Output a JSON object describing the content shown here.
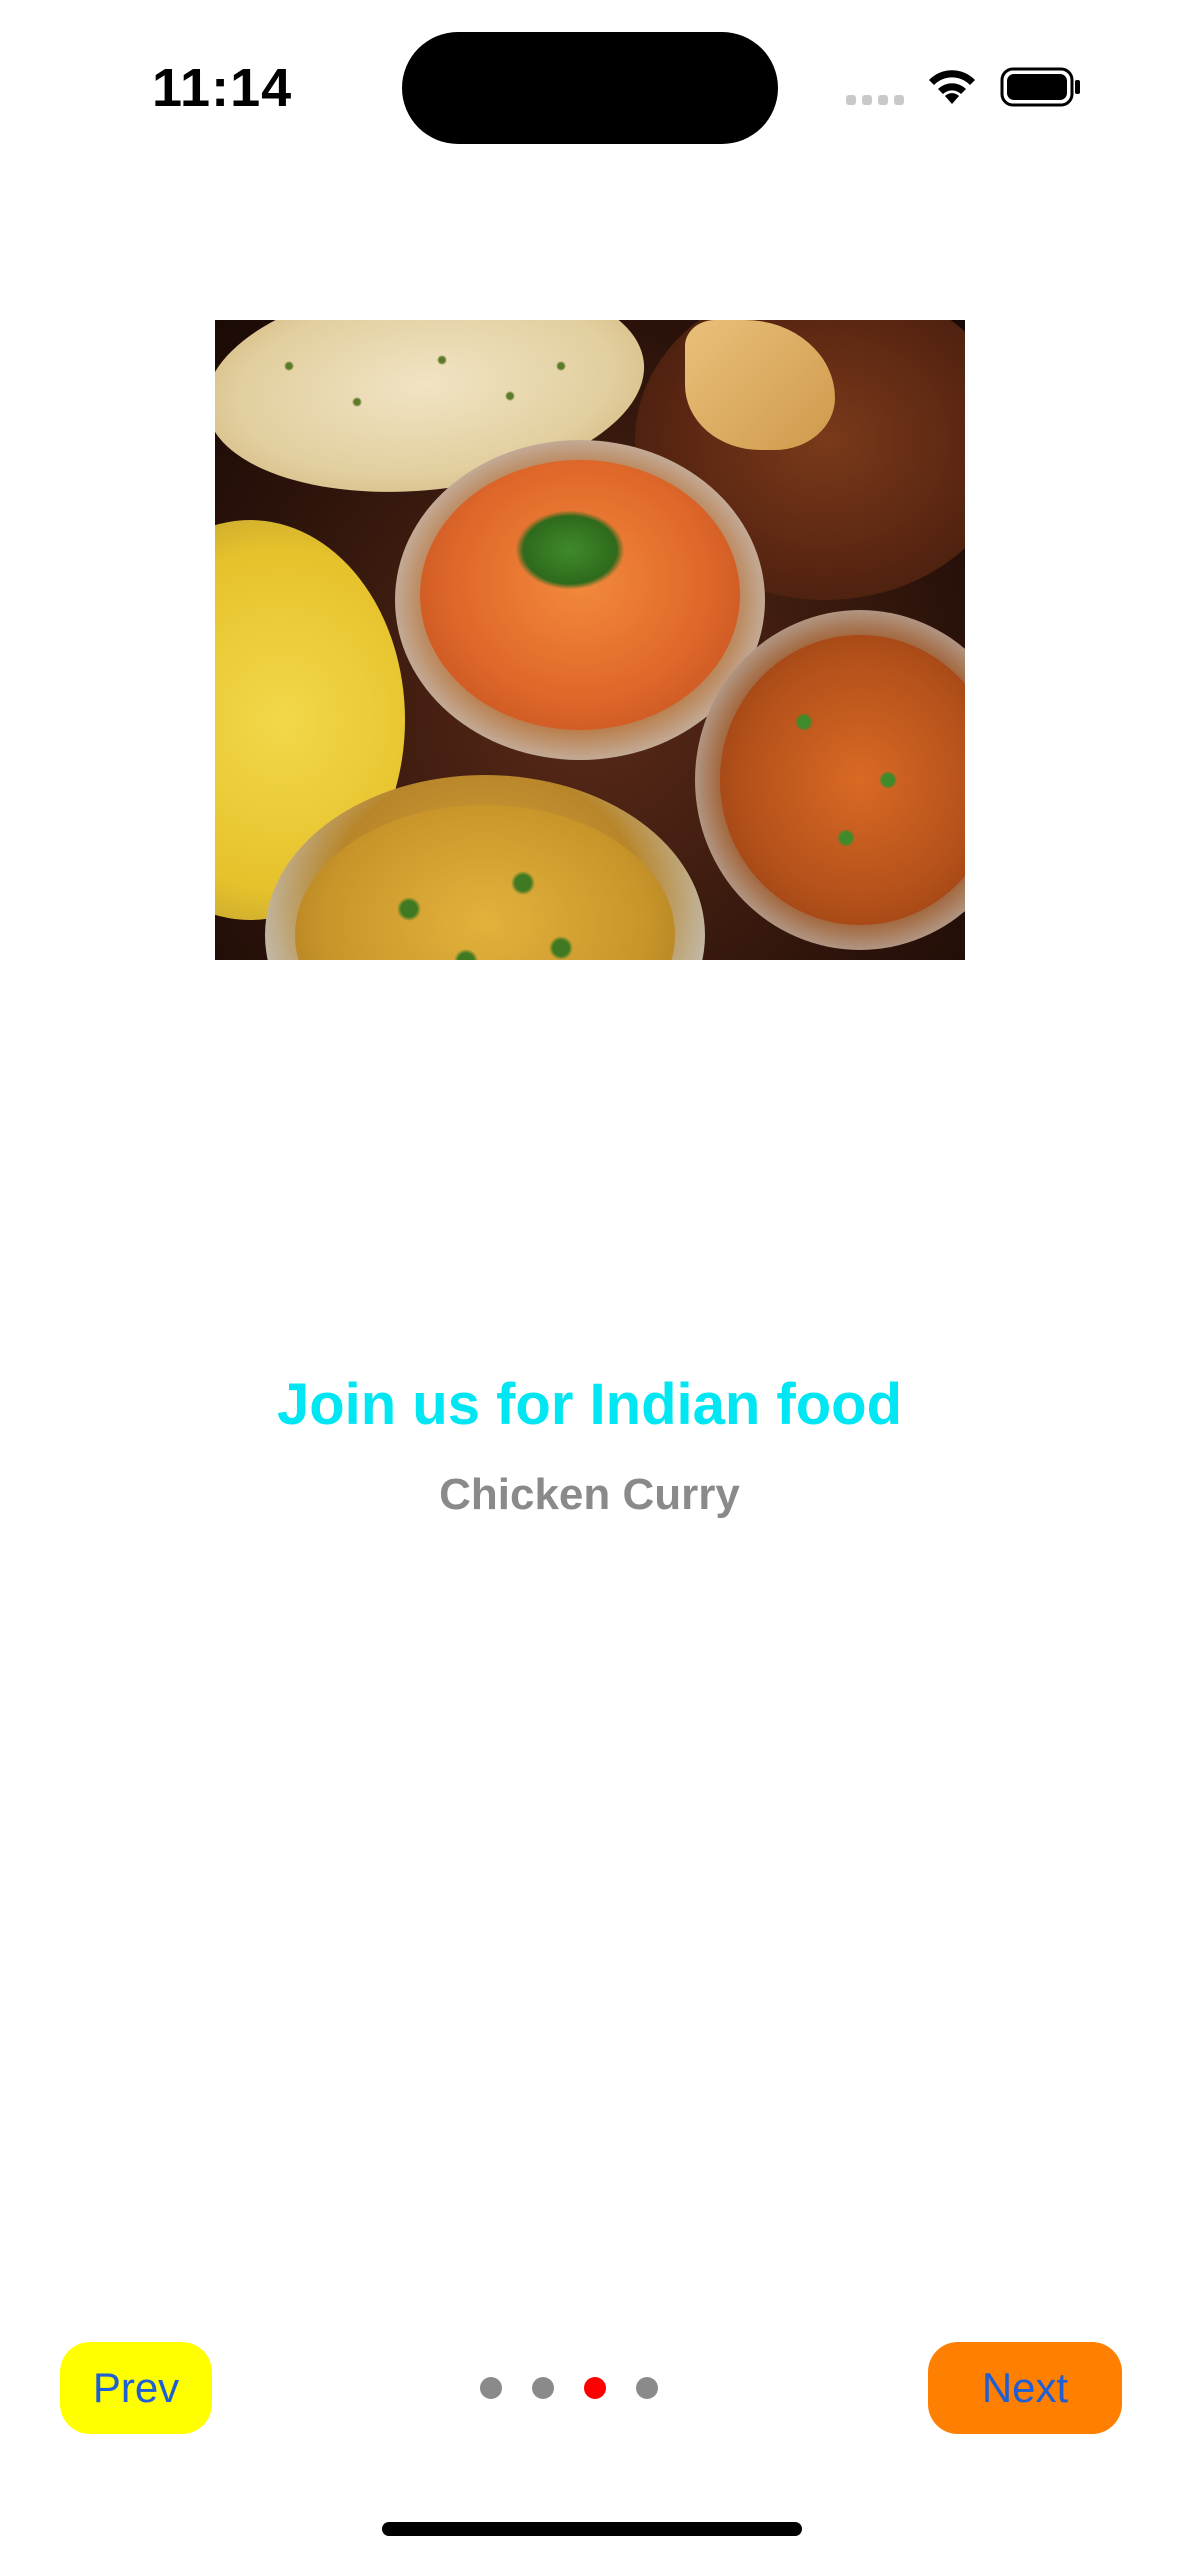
{
  "status_bar": {
    "time": "11:14",
    "icons": [
      "cellular-signal-icon",
      "wifi-icon",
      "battery-icon"
    ]
  },
  "hero_image": {
    "icon": "indian-food-dishes-photo"
  },
  "content": {
    "title": "Join us for Indian food",
    "subtitle": "Chicken Curry"
  },
  "controls": {
    "prev_label": "Prev",
    "next_label": "Next",
    "page_count": 4,
    "current_page": 3
  },
  "colors": {
    "title": "#00e6f2",
    "subtitle": "#8a8a8a",
    "prev_button_bg": "#ffff00",
    "next_button_bg": "#ff7f00",
    "button_text": "#1e5fd6",
    "dot_inactive": "#8a8a8a",
    "dot_active": "#ff0000"
  }
}
